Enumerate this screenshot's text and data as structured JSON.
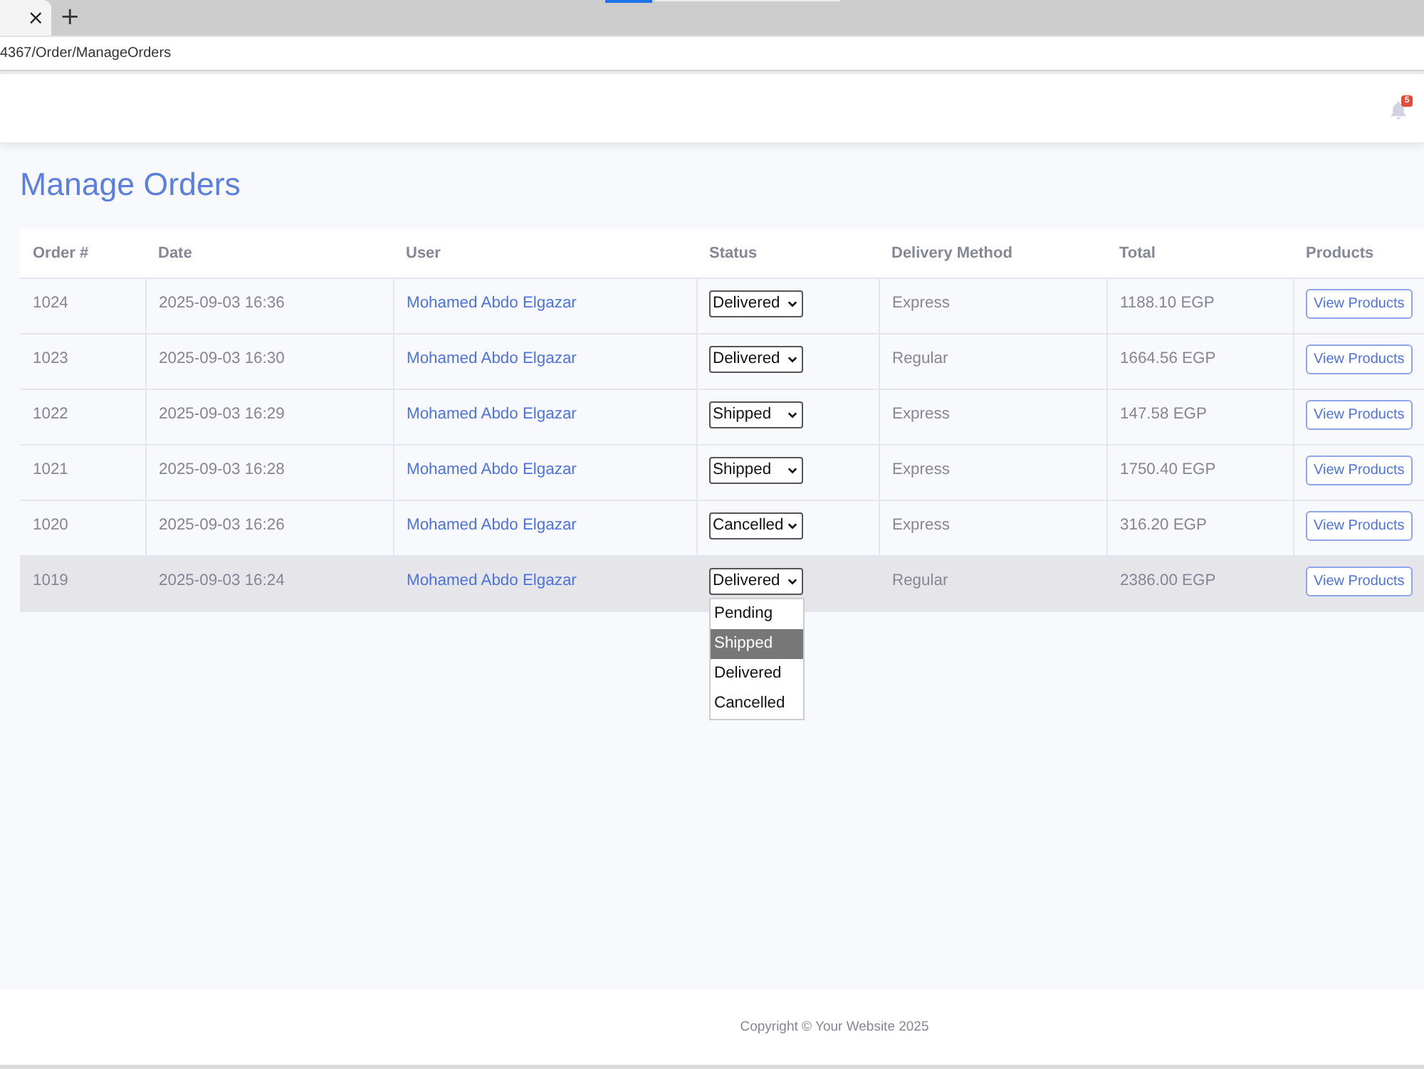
{
  "browser": {
    "tab_close": "×",
    "new_tab": "+",
    "address": "4367/Order/ManageOrders"
  },
  "navbar": {
    "notification_count": "5"
  },
  "page": {
    "title": "Manage Orders"
  },
  "table": {
    "columns": [
      "Order #",
      "Date",
      "User",
      "Status",
      "Delivery Method",
      "Total",
      "Products"
    ],
    "rows": [
      {
        "order": "1024",
        "date": "2025-09-03 16:36",
        "user": "Mohamed Abdo Elgazar",
        "status": "Delivered",
        "delivery_method": "Express",
        "total": "1188.10 EGP",
        "action": "View Products",
        "hovered": false
      },
      {
        "order": "1023",
        "date": "2025-09-03 16:30",
        "user": "Mohamed Abdo Elgazar",
        "status": "Delivered",
        "delivery_method": "Regular",
        "total": "1664.56 EGP",
        "action": "View Products",
        "hovered": false
      },
      {
        "order": "1022",
        "date": "2025-09-03 16:29",
        "user": "Mohamed Abdo Elgazar",
        "status": "Shipped",
        "delivery_method": "Express",
        "total": "147.58 EGP",
        "action": "View Products",
        "hovered": false
      },
      {
        "order": "1021",
        "date": "2025-09-03 16:28",
        "user": "Mohamed Abdo Elgazar",
        "status": "Shipped",
        "delivery_method": "Express",
        "total": "1750.40 EGP",
        "action": "View Products",
        "hovered": false
      },
      {
        "order": "1020",
        "date": "2025-09-03 16:26",
        "user": "Mohamed Abdo Elgazar",
        "status": "Cancelled",
        "delivery_method": "Express",
        "total": "316.20 EGP",
        "action": "View Products",
        "hovered": false
      },
      {
        "order": "1019",
        "date": "2025-09-03 16:24",
        "user": "Mohamed Abdo Elgazar",
        "status": "Delivered",
        "delivery_method": "Regular",
        "total": "2386.00 EGP",
        "action": "View Products",
        "hovered": true,
        "status_options": [
          {
            "label": "Pending",
            "selected": false
          },
          {
            "label": "Shipped",
            "selected": true
          },
          {
            "label": "Delivered",
            "selected": false
          },
          {
            "label": "Cancelled",
            "selected": false
          }
        ]
      }
    ]
  },
  "footer": {
    "copyright": "Copyright © Your Website 2025"
  }
}
